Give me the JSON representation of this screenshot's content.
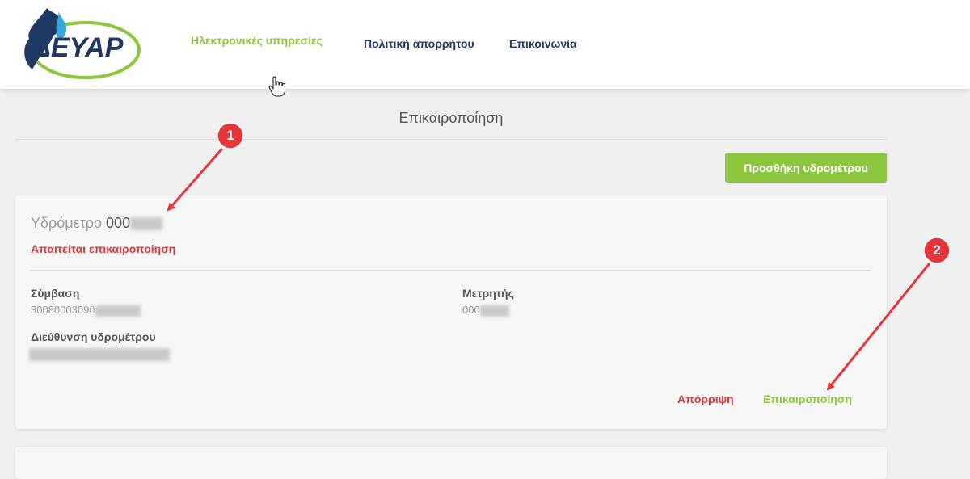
{
  "header": {
    "logo_text": "ΔΕΥΑΡ",
    "nav": {
      "services": "Ηλεκτρονικές υπηρεσίες",
      "privacy": "Πολιτική απορρήτου",
      "contact": "Επικοινωνία"
    }
  },
  "page": {
    "title": "Επικαιροποίηση",
    "add_button": "Προσθήκη υδρομέτρου"
  },
  "card": {
    "meter_prefix": "Υδρόμετρο",
    "meter_number": "000",
    "status": "Απαιτείται επικαιροποίηση",
    "contract_label": "Σύμβαση",
    "contract_value": "30080003090",
    "counter_label": "Μετρητής",
    "counter_value": "000",
    "address_label": "Διεύθυνση υδρομέτρου",
    "reject_label": "Απόρριψη",
    "update_label": "Επικαιροποίηση"
  },
  "annotations": {
    "badge_1": "1",
    "badge_2": "2"
  },
  "colors": {
    "accent_green": "#8cc63f",
    "nav_blue": "#1f3864",
    "alert_red": "#d9383a",
    "annotation_red": "#e8353a"
  }
}
